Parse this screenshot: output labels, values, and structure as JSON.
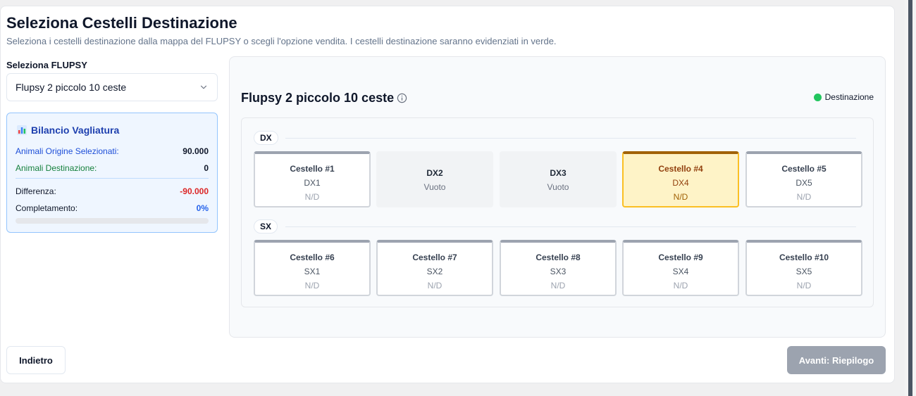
{
  "header": {
    "title": "Seleziona Cestelli Destinazione",
    "subtitle": "Seleziona i cestelli destinazione dalla mappa del FLUPSY o scegli l'opzione vendita. I cestelli destinazione saranno evidenziati in verde."
  },
  "flupsy_select": {
    "label": "Seleziona FLUPSY",
    "value": "Flupsy 2 piccolo 10 ceste"
  },
  "balance": {
    "icon": "bar-chart-icon",
    "title": "Bilancio Vagliatura",
    "origin_label": "Animali Origine Selezionati:",
    "origin_value": "90.000",
    "dest_label": "Animali Destinazione:",
    "dest_value": "0",
    "diff_label": "Differenza:",
    "diff_value": "-90.000",
    "completion_label": "Completamento:",
    "completion_value": "0%",
    "completion_fraction": 0,
    "colors": {
      "origin": "#1d4ed8",
      "dest": "#15803d",
      "diff": "#dc2626",
      "completion": "#2563eb"
    }
  },
  "map": {
    "title": "Flupsy 2 piccolo 10 ceste",
    "legend_label": "Destinazione",
    "legend_color": "#22c55e",
    "rows": [
      {
        "tag": "DX",
        "cells": [
          {
            "state": "basket",
            "name": "Cestello #1",
            "position": "DX1",
            "info": "N/D"
          },
          {
            "state": "empty",
            "name": "DX2",
            "position": "Vuoto"
          },
          {
            "state": "empty",
            "name": "DX3",
            "position": "Vuoto"
          },
          {
            "state": "highlight",
            "name": "Cestello #4",
            "position": "DX4",
            "info": "N/D"
          },
          {
            "state": "basket",
            "name": "Cestello #5",
            "position": "DX5",
            "info": "N/D"
          }
        ]
      },
      {
        "tag": "SX",
        "cells": [
          {
            "state": "basket",
            "name": "Cestello #6",
            "position": "SX1",
            "info": "N/D"
          },
          {
            "state": "basket",
            "name": "Cestello #7",
            "position": "SX2",
            "info": "N/D"
          },
          {
            "state": "basket",
            "name": "Cestello #8",
            "position": "SX3",
            "info": "N/D"
          },
          {
            "state": "basket",
            "name": "Cestello #9",
            "position": "SX4",
            "info": "N/D"
          },
          {
            "state": "basket",
            "name": "Cestello #10",
            "position": "SX5",
            "info": "N/D"
          }
        ]
      }
    ]
  },
  "footer": {
    "back_label": "Indietro",
    "next_label": "Avanti: Riepilogo"
  }
}
